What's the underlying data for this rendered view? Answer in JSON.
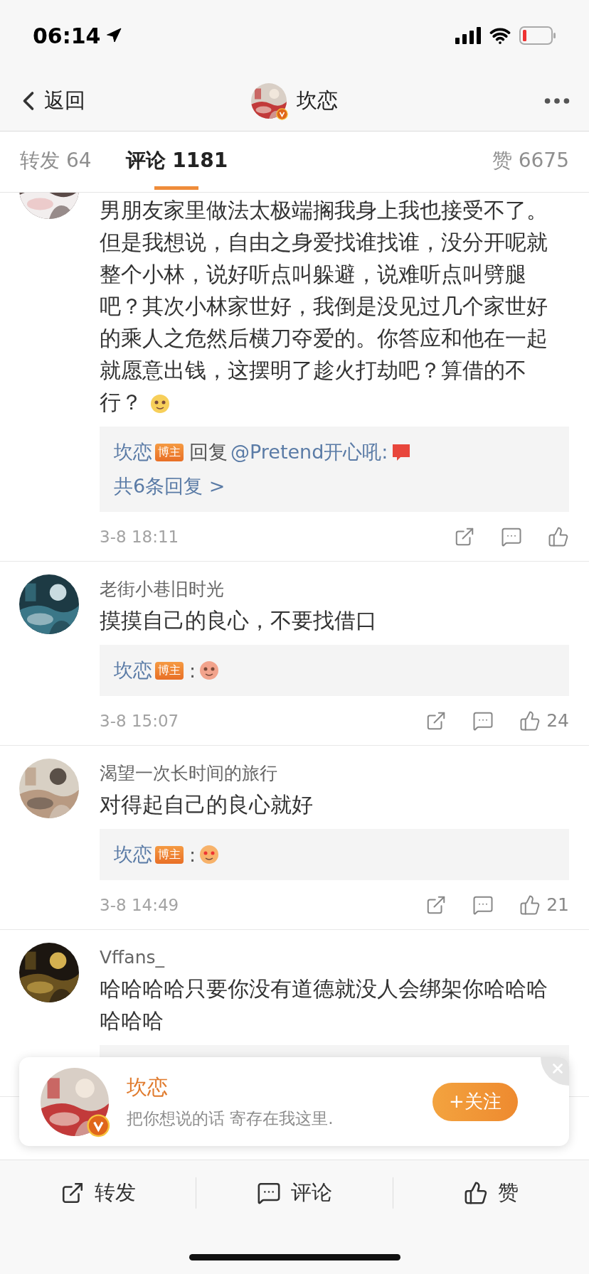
{
  "status_bar": {
    "time": "06:14"
  },
  "nav": {
    "back": "返回",
    "title": "坎恋"
  },
  "tabs": [
    {
      "label": "转发 64",
      "selected": false
    },
    {
      "label": "评论 1181",
      "selected": true
    },
    {
      "label": "赞 6675",
      "selected": false
    }
  ],
  "comments": [
    {
      "kind": "cut",
      "text": "男朋友家里做法太极端搁我身上我也接受不了。但是我想说，自由之身爱找谁找谁，没分开呢就整个小林，说好听点叫躲避，说难听点叫劈腿吧？其次小林家世好，我倒是没见过几个家世好的乘人之危然后横刀夺爱的。你答应和他在一起就愿意出钱，这摆明了趁火打劫吧？算借的不行？",
      "emoji": true,
      "reply": {
        "kind": "thread",
        "author": "坎恋",
        "badge": "博主",
        "action": "回复",
        "mention": "@Pretend开心吼:",
        "sticker": true,
        "more": "共6条回复 >"
      },
      "time": "3-8 18:11"
    },
    {
      "kind": "full",
      "author": "老街小巷旧时光",
      "text": "摸摸自己的良心，不要找借口",
      "reply": {
        "kind": "sticker",
        "author": "坎恋",
        "badge": "博主",
        "colon": ":",
        "sticker": true
      },
      "time": "3-8 15:07",
      "likes": "24"
    },
    {
      "kind": "full",
      "author": "渴望一次长时间的旅行",
      "text": "对得起自己的良心就好",
      "reply": {
        "kind": "sticker",
        "author": "坎恋",
        "badge": "博主",
        "colon": ":",
        "sticker": true
      },
      "time": "3-8 14:49",
      "likes": "21"
    },
    {
      "kind": "full",
      "author": "Vffans_",
      "text": "哈哈哈哈只要你没有道德就没人会绑架你哈哈哈哈哈哈",
      "reply": {
        "kind": "covered"
      }
    }
  ],
  "popup": {
    "name": "坎恋",
    "tagline": "把你想说的话 寄存在我这里.",
    "follow": "+关注"
  },
  "actions": [
    {
      "kind": "repost",
      "label": "转发"
    },
    {
      "kind": "comment",
      "label": "评论"
    },
    {
      "kind": "like",
      "label": "赞"
    }
  ]
}
